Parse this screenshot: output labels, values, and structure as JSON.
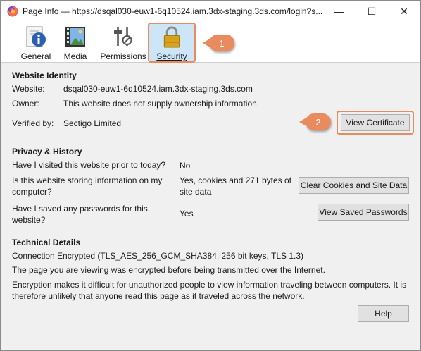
{
  "window": {
    "title": "Page Info — https://dsqal030-euw1-6q10524.iam.3dx-staging.3ds.com/login?s...",
    "minimize_glyph": "—",
    "maximize_glyph": "☐",
    "close_glyph": "✕"
  },
  "tabs": [
    {
      "label": "General",
      "icon": "info-icon"
    },
    {
      "label": "Media",
      "icon": "media-icon"
    },
    {
      "label": "Permissions",
      "icon": "permissions-icon"
    },
    {
      "label": "Security",
      "icon": "lock-icon",
      "selected": true
    }
  ],
  "callouts": {
    "one": "1",
    "two": "2"
  },
  "identity": {
    "heading": "Website Identity",
    "website_label": "Website:",
    "website_value": "dsqal030-euw1-6q10524.iam.3dx-staging.3ds.com",
    "owner_label": "Owner:",
    "owner_value": "This website does not supply ownership information.",
    "verified_label": "Verified by:",
    "verified_value": "Sectigo Limited",
    "view_cert_button": "View Certificate"
  },
  "privacy": {
    "heading": "Privacy & History",
    "visited_q": "Have I visited this website prior to today?",
    "visited_a": "No",
    "storing_q": "Is this website storing information on my computer?",
    "storing_a": "Yes, cookies and 271 bytes of site data",
    "clear_button": "Clear Cookies and Site Data",
    "passwords_q": "Have I saved any passwords for this website?",
    "passwords_a": "Yes",
    "view_passwords_button": "View Saved Passwords"
  },
  "technical": {
    "heading": "Technical Details",
    "connection": "Connection Encrypted (TLS_AES_256_GCM_SHA384, 256 bit keys, TLS 1.3)",
    "line1": "The page you are viewing was encrypted before being transmitted over the Internet.",
    "line2": "Encryption makes it difficult for unauthorized people to view information traveling between computers. It is therefore unlikely that anyone read this page as it traveled across the network."
  },
  "footer": {
    "help_button": "Help"
  },
  "colors": {
    "callout": "#e98a5f",
    "selected_tab": "#cde6f7",
    "panel_bg": "#f0f0f0"
  }
}
